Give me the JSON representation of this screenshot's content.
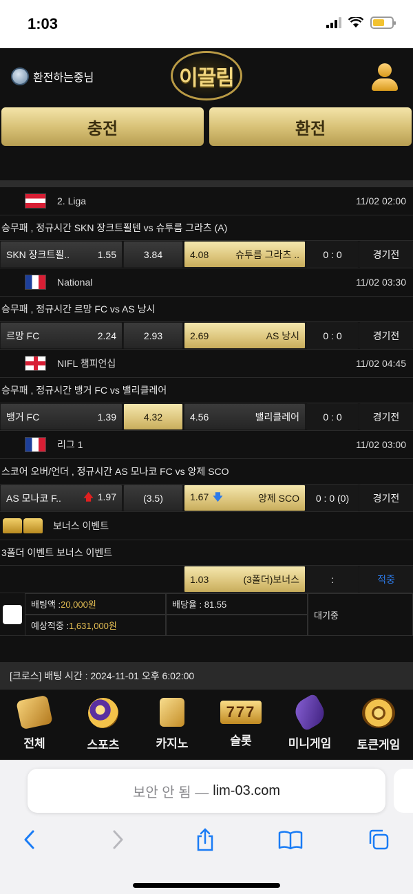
{
  "status_bar": {
    "time": "1:03"
  },
  "header": {
    "user_name": "환전하는중님",
    "logo_text": "이끌림",
    "charge_label": "충전",
    "exchange_label": "환전"
  },
  "matches": [
    {
      "league": "2. Liga",
      "flag": "austria-flag-icon",
      "datetime": "11/02 02:00",
      "description": "승무패 , 정규시간 SKN 장크트푈텐  vs  슈투름 그라츠 (A)",
      "home_name": "SKN 장크트푈..",
      "home_odds": "1.55",
      "draw_odds": "3.84",
      "away_odds": "4.08",
      "away_name": "슈투름 그라츠 ..",
      "score": "0 : 0",
      "status": "경기전",
      "selected": "away"
    },
    {
      "league": "National",
      "flag": "france-flag-icon",
      "datetime": "11/02 03:30",
      "description": "승무패 , 정규시간 르망 FC  vs  AS 낭시",
      "home_name": "르망 FC",
      "home_odds": "2.24",
      "draw_odds": "2.93",
      "away_odds": "2.69",
      "away_name": "AS 낭시",
      "score": "0 : 0",
      "status": "경기전",
      "selected": "away"
    },
    {
      "league": "NIFL 챔피언십",
      "flag": "england-flag-icon",
      "datetime": "11/02 04:45",
      "description": "승무패 , 정규시간 뱅거 FC  vs  밸리클레어",
      "home_name": "뱅거 FC",
      "home_odds": "1.39",
      "draw_odds": "4.32",
      "away_odds": "4.56",
      "away_name": "밸리클레어",
      "score": "0 : 0",
      "status": "경기전",
      "selected": "draw"
    },
    {
      "league": "리그 1",
      "flag": "france-flag-icon",
      "datetime": "11/02 03:00",
      "description": "스코어 오버/언더 , 정규시간 AS 모나코 FC  vs  앙제 SCO",
      "home_name": "AS 모나코 F..",
      "home_odds": "1.97",
      "draw_odds": "(3.5)",
      "away_odds": "1.67",
      "away_name": "앙제 SCO",
      "score": "0 : 0 (0)",
      "status": "경기전",
      "selected": "away"
    }
  ],
  "bonus": {
    "title": "보너스 이벤트",
    "description": "3폴더 이벤트 보너스 이벤트",
    "odds": "1.03",
    "name": "(3폴더)보너스",
    "score": ":",
    "status": "적중"
  },
  "bet_summary": {
    "bet_amount_label": "배팅액 : ",
    "bet_amount_value": "20,000원",
    "rate_label": "배당율 : 81.55",
    "expected_label": "예상적중 : ",
    "expected_value": "1,631,000원",
    "result": "대기중"
  },
  "bet_time": "[크로스] 배팅 시간 : 2024-11-01 오후 6:02:00",
  "nav": [
    {
      "label": "전체",
      "icon": "dice-icon"
    },
    {
      "label": "스포츠",
      "icon": "soccer-ball-icon"
    },
    {
      "label": "카지노",
      "icon": "cards-icon"
    },
    {
      "label": "슬롯",
      "icon": "slot-777-icon"
    },
    {
      "label": "미니게임",
      "icon": "rocket-icon"
    },
    {
      "label": "토큰게임",
      "icon": "roulette-icon"
    }
  ],
  "browser": {
    "security_text": "보안 안 됨 —",
    "domain": "lim-03.com"
  },
  "colors": {
    "gold": "#dcc57c",
    "background": "#111111",
    "bonus_status": "#2d7ae8"
  }
}
